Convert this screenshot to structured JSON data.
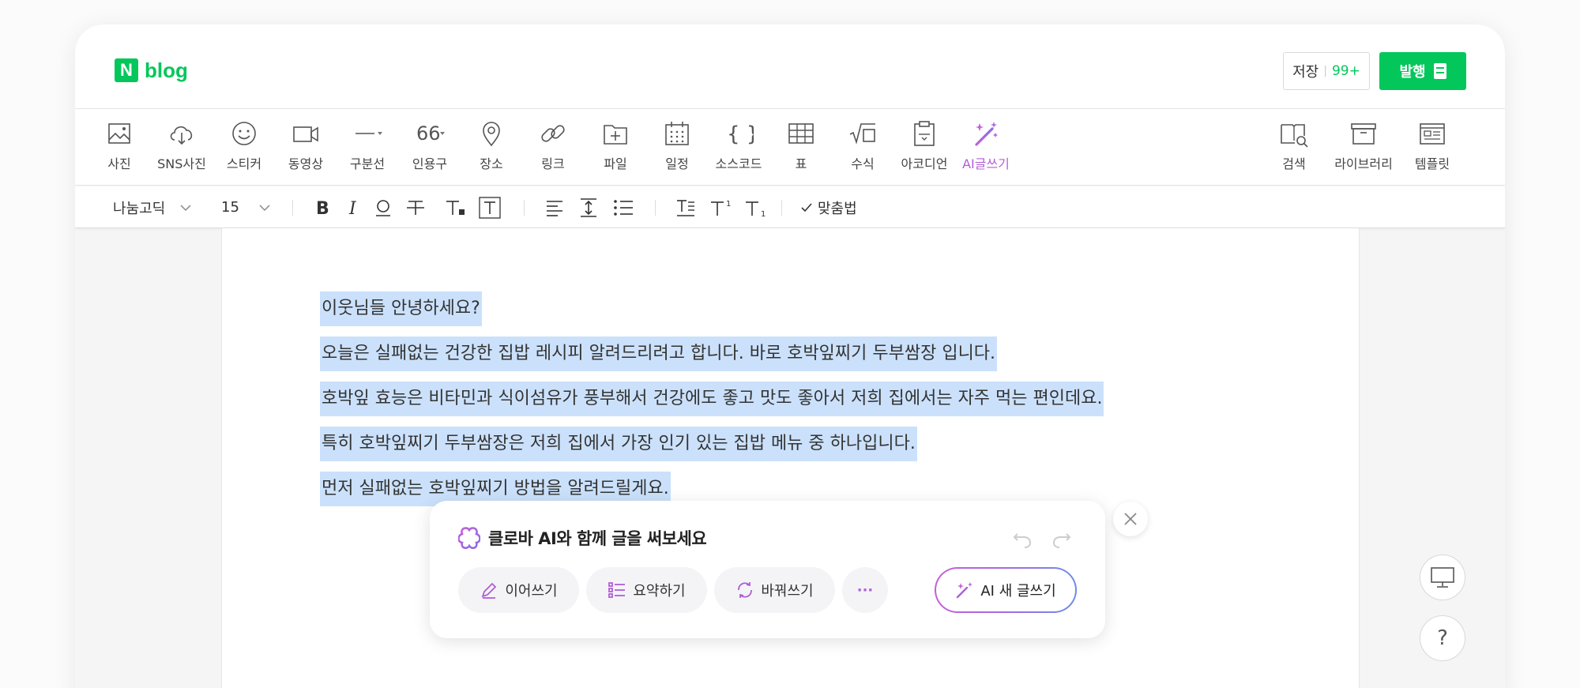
{
  "header": {
    "logo_mark": "N",
    "logo_text": "blog",
    "save_label": "저장",
    "save_count": "99+",
    "publish_label": "발행"
  },
  "insert_toolbar": {
    "items": [
      {
        "label": "사진",
        "icon": "photo-icon"
      },
      {
        "label": "SNS사진",
        "icon": "cloud-download-icon"
      },
      {
        "label": "스티커",
        "icon": "smiley-icon"
      },
      {
        "label": "동영상",
        "icon": "video-icon"
      },
      {
        "label": "구분선",
        "icon": "divider-icon"
      },
      {
        "label": "인용구",
        "icon": "quote-icon"
      },
      {
        "label": "장소",
        "icon": "location-pin-icon"
      },
      {
        "label": "링크",
        "icon": "link-icon"
      },
      {
        "label": "파일",
        "icon": "file-add-icon"
      },
      {
        "label": "일정",
        "icon": "calendar-icon"
      },
      {
        "label": "소스코드",
        "icon": "code-braces-icon"
      },
      {
        "label": "표",
        "icon": "table-icon"
      },
      {
        "label": "수식",
        "icon": "formula-icon"
      },
      {
        "label": "아코디언",
        "icon": "accordion-icon"
      },
      {
        "label": "AI글쓰기",
        "icon": "ai-wand-icon"
      }
    ],
    "right_items": [
      {
        "label": "검색",
        "icon": "book-search-icon"
      },
      {
        "label": "라이브러리",
        "icon": "library-box-icon"
      },
      {
        "label": "템플릿",
        "icon": "template-icon"
      }
    ],
    "ai_color": "#b05fd6"
  },
  "format_toolbar": {
    "font": "나눔고딕",
    "size": "15",
    "spellcheck_label": "맞춤법"
  },
  "editor": {
    "paragraphs": [
      "이웃님들 안녕하세요?",
      "오늘은 실패없는 건강한 집밥 레시피 알려드리려고 합니다. 바로 호박잎찌기 두부쌈장 입니다.",
      "호박잎 효능은 비타민과 식이섬유가 풍부해서 건강에도 좋고 맛도 좋아서 저희 집에서는 자주 먹는 편인데요.",
      "특히 호박잎찌기 두부쌈장은 저희 집에서 가장 인기 있는 집밥 메뉴 중 하나입니다.",
      "먼저 실패없는 호박잎찌기 방법을 알려드릴게요."
    ],
    "selection_color": "#cbe1fb"
  },
  "ai_popup": {
    "title": "클로바 AI와 함께 글을 써보세요",
    "continue_label": "이어쓰기",
    "summarize_label": "요약하기",
    "rewrite_label": "바꿔쓰기",
    "more_label": "···",
    "new_write_label": "AI 새 글쓰기"
  },
  "colors": {
    "brand_green": "#03c75a",
    "ai_purple": "#b05fd6"
  }
}
